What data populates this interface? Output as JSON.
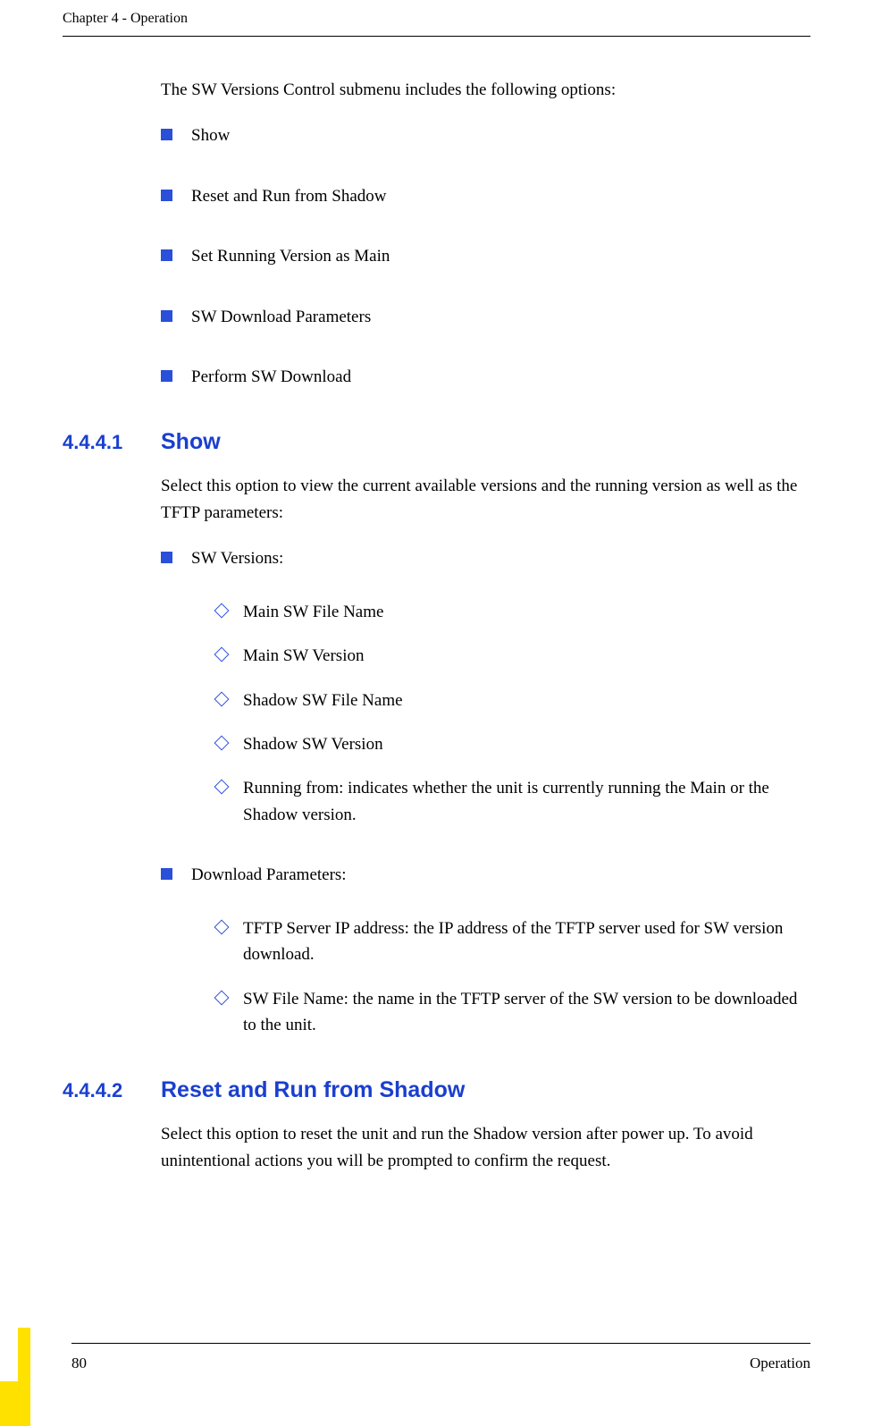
{
  "header": {
    "chapter": "Chapter 4 - Operation"
  },
  "intro": "The SW Versions Control submenu includes the following options:",
  "options": [
    "Show",
    "Reset and Run from Shadow",
    "Set Running Version as Main",
    "SW Download Parameters",
    "Perform SW Download"
  ],
  "s1": {
    "num": "4.4.4.1",
    "title": "Show",
    "para": "Select this option to view the current available versions and the running version as well as the TFTP parameters:",
    "group1_label": "SW Versions:",
    "group1_items": [
      "Main SW File Name",
      "Main SW Version",
      "Shadow SW File Name",
      "Shadow SW Version",
      "Running from: indicates whether the unit is currently running the Main or the Shadow version."
    ],
    "group2_label": "Download Parameters:",
    "group2_items": [
      "TFTP Server IP address: the IP address of the TFTP server used for SW version download.",
      "SW File Name: the name in the TFTP server of the SW version to be downloaded to the unit."
    ]
  },
  "s2": {
    "num": "4.4.4.2",
    "title": "Reset and Run from Shadow",
    "para": "Select this option to reset the unit and run the Shadow version after power up. To avoid unintentional actions you will be prompted to confirm the request."
  },
  "footer": {
    "page": "80",
    "section": "Operation"
  }
}
